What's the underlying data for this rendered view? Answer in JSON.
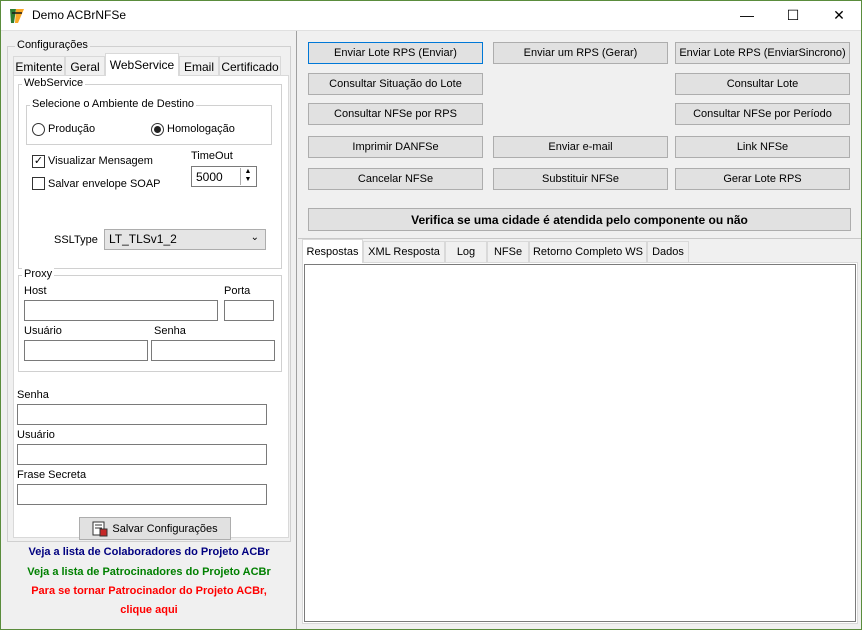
{
  "window": {
    "title": "Demo ACBrNFSe",
    "minimize": "—",
    "maximize": "☐",
    "close": "✕"
  },
  "config": {
    "group_label": "Configurações",
    "tabs": [
      "Emitente",
      "Geral",
      "WebService",
      "Email",
      "Certificado"
    ],
    "webservice": {
      "group_label": "WebService",
      "ambiente_label": "Selecione o Ambiente de Destino",
      "producao": "Produção",
      "homologacao": "Homologação",
      "visualizar": "Visualizar Mensagem",
      "salvar_soap": "Salvar envelope SOAP",
      "timeout_label": "TimeOut",
      "timeout_value": "5000",
      "ssltype_label": "SSLType",
      "ssltype_value": "LT_TLSv1_2"
    },
    "proxy": {
      "group_label": "Proxy",
      "host": "Host",
      "porta": "Porta",
      "usuario": "Usuário",
      "senha": "Senha"
    },
    "extra": {
      "senha": "Senha",
      "usuario": "Usuário",
      "frase": "Frase Secreta"
    },
    "save_button": "Salvar Configurações"
  },
  "links": {
    "colaboradores": "Veja a lista de Colaboradores do Projeto ACBr",
    "patrocinadores": "Veja a lista de Patrocinadores do Projeto ACBr",
    "tornar_line1": "Para se tornar Patrocinador do Projeto ACBr,",
    "tornar_line2": "clique aqui"
  },
  "actions": {
    "enviar_lote": "Enviar Lote RPS (Enviar)",
    "enviar_um": "Enviar um RPS (Gerar)",
    "enviar_sinc": "Enviar Lote RPS (EnviarSincrono)",
    "cons_situacao": "Consultar Situação do Lote",
    "cons_lote": "Consultar Lote",
    "cons_rps": "Consultar NFSe por RPS",
    "cons_periodo": "Consultar NFSe por Período",
    "imprimir": "Imprimir DANFSe",
    "email": "Enviar e-mail",
    "link": "Link NFSe",
    "cancelar": "Cancelar NFSe",
    "substituir": "Substituir NFSe",
    "gerar": "Gerar Lote RPS",
    "verifica": "Verifica se uma cidade é atendida pelo componente ou não"
  },
  "result_tabs": [
    "Respostas",
    "XML Resposta",
    "Log",
    "NFSe",
    "Retorno Completo WS",
    "Dados"
  ],
  "colors": {
    "link_blue": "#000080",
    "link_green": "#008000",
    "link_red": "#ff0000",
    "focus": "#0078d7"
  }
}
